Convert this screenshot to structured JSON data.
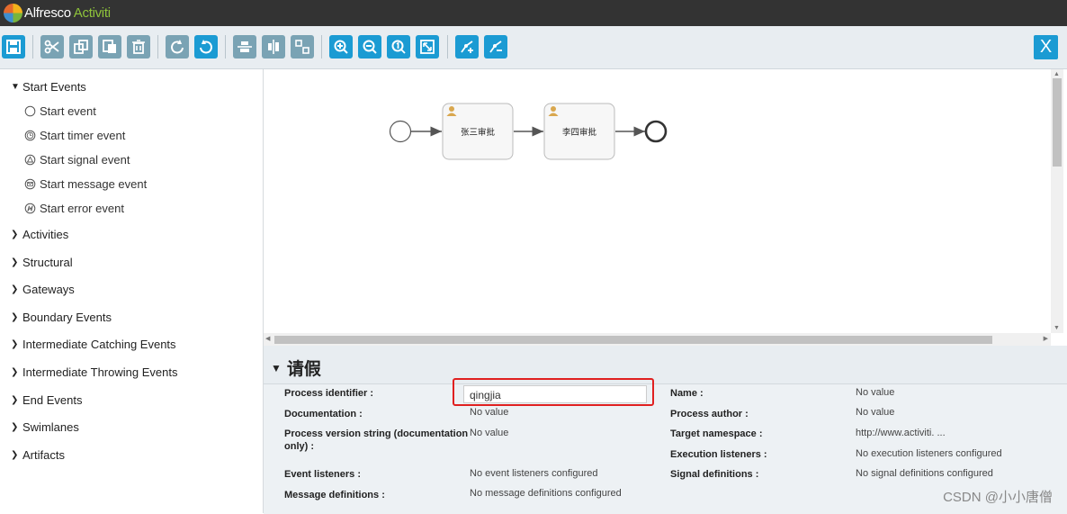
{
  "app": {
    "name_part1": "Alfresco",
    "name_part2": "Activiti"
  },
  "toolbar": {
    "buttons": [
      {
        "name": "save",
        "icon": "save-icon"
      },
      {
        "name": "cut",
        "icon": "scissors-icon"
      },
      {
        "name": "copy",
        "icon": "copy-icon"
      },
      {
        "name": "paste",
        "icon": "paste-icon"
      },
      {
        "name": "delete",
        "icon": "trash-icon"
      },
      {
        "name": "redo",
        "icon": "redo-icon"
      },
      {
        "name": "undo",
        "icon": "undo-icon"
      },
      {
        "name": "align-horizontal",
        "icon": "align-horizontal-icon"
      },
      {
        "name": "align-vertical",
        "icon": "align-vertical-icon"
      },
      {
        "name": "same-size",
        "icon": "same-size-icon"
      },
      {
        "name": "zoom-in",
        "icon": "zoom-in-icon"
      },
      {
        "name": "zoom-out",
        "icon": "zoom-out-icon"
      },
      {
        "name": "zoom-actual",
        "icon": "zoom-actual-icon"
      },
      {
        "name": "zoom-fit",
        "icon": "zoom-fit-icon"
      },
      {
        "name": "add-bendpoint",
        "icon": "add-bendpoint-icon"
      },
      {
        "name": "remove-bendpoint",
        "icon": "remove-bendpoint-icon"
      }
    ],
    "close_label": "X"
  },
  "palette": {
    "start_events": {
      "label": "Start Events",
      "items": [
        {
          "label": "Start event",
          "icon": "circle-icon"
        },
        {
          "label": "Start timer event",
          "icon": "timer-icon"
        },
        {
          "label": "Start signal event",
          "icon": "signal-icon"
        },
        {
          "label": "Start message event",
          "icon": "message-icon"
        },
        {
          "label": "Start error event",
          "icon": "error-icon"
        }
      ]
    },
    "groups": [
      "Activities",
      "Structural",
      "Gateways",
      "Boundary Events",
      "Intermediate Catching Events",
      "Intermediate Throwing Events",
      "End Events",
      "Swimlanes",
      "Artifacts"
    ]
  },
  "diagram": {
    "task1_label": "张三审批",
    "task2_label": "李四审批"
  },
  "properties": {
    "title": "请假",
    "process_identifier_label": "Process identifier :",
    "process_identifier_value": "qingjia",
    "documentation_label": "Documentation :",
    "documentation_value": "No value",
    "version_label": "Process version string (documentation only) :",
    "version_value": "No value",
    "event_listeners_label": "Event listeners :",
    "event_listeners_value": "No event listeners configured",
    "message_definitions_label": "Message definitions :",
    "message_definitions_value": "No message definitions configured",
    "name_label": "Name :",
    "name_value": "No value",
    "author_label": "Process author :",
    "author_value": "No value",
    "namespace_label": "Target namespace :",
    "namespace_value": "http://www.activiti. ...",
    "execution_listeners_label": "Execution listeners :",
    "execution_listeners_value": "No execution listeners configured",
    "signal_definitions_label": "Signal definitions :",
    "signal_definitions_value": "No signal definitions configured"
  },
  "watermark": "CSDN @小小唐僧"
}
